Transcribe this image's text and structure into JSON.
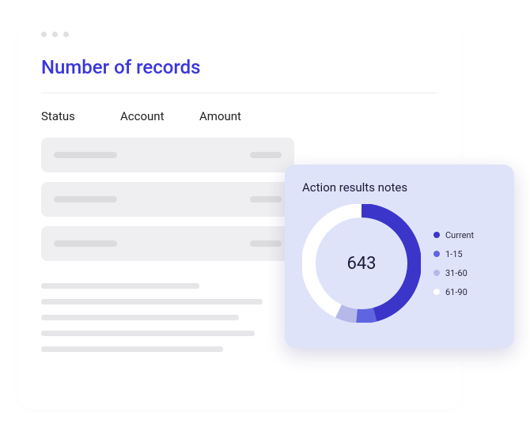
{
  "window": {
    "title": "Number of records",
    "columns": [
      "Status",
      "Account",
      "Amount"
    ]
  },
  "panel": {
    "title": "Action results notes",
    "center_value": "643",
    "legend": [
      {
        "label": "Current",
        "color": "#3b35c9"
      },
      {
        "label": "1-15",
        "color": "#5f65e0"
      },
      {
        "label": "31-60",
        "color": "#b6b8e9"
      },
      {
        "label": "61-90",
        "color": "#ffffff"
      }
    ]
  },
  "chart_data": {
    "type": "pie",
    "title": "Action results notes",
    "total": 643,
    "series": [
      {
        "name": "Current",
        "value": 312,
        "color": "#3b35c9"
      },
      {
        "name": "1-15",
        "value": 36,
        "color": "#5f65e0"
      },
      {
        "name": "31-60",
        "value": 33,
        "color": "#b6b8e9"
      },
      {
        "name": "61-90",
        "value": 262,
        "color": "#ffffff"
      }
    ]
  }
}
